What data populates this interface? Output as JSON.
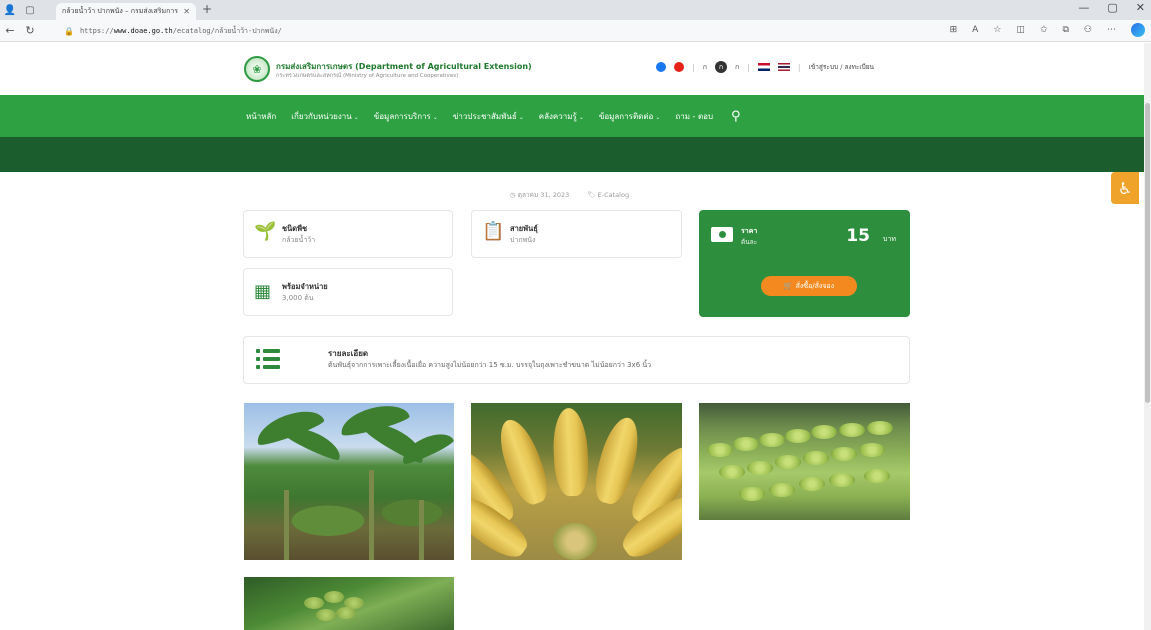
{
  "browser": {
    "tab_title": "กล้วยน้ำว้า ปากพนัง – กรมส่งเสริมการ",
    "url_prefix": "https://",
    "url_host": "www.doae.go.th",
    "url_path": "/ecatalog/กล้วยน้ำว้า-ปากพนัง/"
  },
  "header": {
    "brand_th": "กรมส่งเสริมการเกษตร (Department of Agricultural Extension)",
    "brand_en": "กระทรวงเกษตรและสหกรณ์ (Ministry of Agriculture and Cooperatives)",
    "font_minus": "ก",
    "font_normal": "ก",
    "font_plus": "ก",
    "login": "เข้าสู่ระบบ / ลงทะเบียน"
  },
  "nav": {
    "items": [
      {
        "label": "หน้าหลัก",
        "has_caret": false
      },
      {
        "label": "เกี่ยวกับหน่วยงาน",
        "has_caret": true
      },
      {
        "label": "ข้อมูลการบริการ",
        "has_caret": true
      },
      {
        "label": "ข่าวประชาสัมพันธ์",
        "has_caret": true
      },
      {
        "label": "คลังความรู้",
        "has_caret": true
      },
      {
        "label": "ข้อมูลการติดต่อ",
        "has_caret": true
      },
      {
        "label": "ถาม - ตอบ",
        "has_caret": false
      }
    ]
  },
  "post": {
    "date": "ตุลาคม 31, 2023",
    "category": "E-Catalog"
  },
  "cards": {
    "plant_type_label": "ชนิดพืช",
    "plant_type_value": "กล้วยน้ำว้า",
    "variety_label": "สายพันธุ์",
    "variety_value": "ปากพนัง",
    "available_label": "พร้อมจำหน่าย",
    "available_value": "3,000 ต้น",
    "price_label": "ราคา",
    "price_unit": "ต้นละ",
    "price_value": "15",
    "price_currency": "บาท",
    "order_button": "สั่งซื้อ/สั่งจอง"
  },
  "detail": {
    "title": "รายละเอียด",
    "text": "ต้นพันธุ์จากการเพาะเลี้ยงเนื้อเยื่อ ความสูงไม่น้อยกว่า 15 ซ.ม. บรรจุในถุงเพาะชำขนาด ไม่น้อยกว่า 3x6 นิ้ว"
  },
  "colors": {
    "nav_green": "#2ea243",
    "dark_band": "#1b5d2d",
    "price_green": "#2d8f3d",
    "order_orange": "#f48a1f",
    "a11y_orange": "#f0a32a"
  },
  "icons": {
    "plant": "sprout-icon",
    "variety": "clipboard-icon",
    "price": "banknote-icon",
    "stock": "boxes-icon",
    "detail": "list-icon",
    "accessibility": "wheelchair-icon"
  }
}
